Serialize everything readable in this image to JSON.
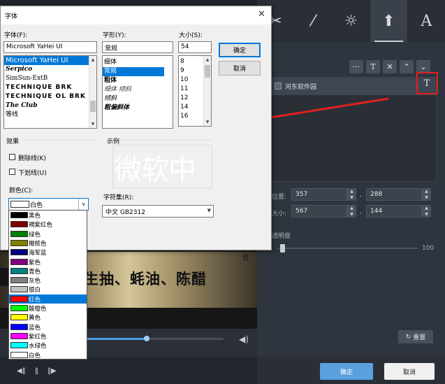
{
  "dialog": {
    "title": "字体",
    "font_label": "字体(F):",
    "font_value": "Microsoft YaHei UI",
    "font_list": [
      "Microsoft YaHei UI",
      "Serpico",
      "SimSun-ExtB",
      "TECHNIQUE BRK",
      "TECHNIQUE OL BRK",
      "The Club",
      "等线"
    ],
    "style_label": "字形(Y):",
    "style_value": "常规",
    "style_list": [
      "细体",
      "常规",
      "粗体",
      "细体 倾斜",
      "倾斜",
      "粗偏斜体"
    ],
    "size_label": "大小(S):",
    "size_value": "54",
    "size_list": [
      "8",
      "9",
      "10",
      "11",
      "12",
      "14",
      "16"
    ],
    "ok_label": "确定",
    "cancel_label": "取消",
    "effects_label": "效果",
    "strikeout_label": "删除线(K)",
    "underline_label": "下划线(U)",
    "color_label": "颜色(C):",
    "color_value": "白色",
    "sample_label": "示例",
    "sample_text": "微软中",
    "charset_label": "字符集(R):",
    "charset_value": "中文 GB2312",
    "colors": [
      {
        "name": "黑色",
        "hex": "#000000"
      },
      {
        "name": "褐紫红色",
        "hex": "#800000"
      },
      {
        "name": "绿色",
        "hex": "#008000"
      },
      {
        "name": "橄榄色",
        "hex": "#808000"
      },
      {
        "name": "海军蓝",
        "hex": "#000080"
      },
      {
        "name": "紫色",
        "hex": "#800080"
      },
      {
        "name": "青色",
        "hex": "#008080"
      },
      {
        "name": "灰色",
        "hex": "#808080"
      },
      {
        "name": "银白",
        "hex": "#c0c0c0"
      },
      {
        "name": "红色",
        "hex": "#ff0000"
      },
      {
        "name": "酸橙色",
        "hex": "#00ff00"
      },
      {
        "name": "黄色",
        "hex": "#ffff00"
      },
      {
        "name": "蓝色",
        "hex": "#0000ff"
      },
      {
        "name": "紫红色",
        "hex": "#ff00ff"
      },
      {
        "name": "水绿色",
        "hex": "#00ffff"
      },
      {
        "name": "白色",
        "hex": "#ffffff"
      }
    ],
    "selected_color_index": 9
  },
  "video": {
    "subtitle": "生抽、蚝油、陈醋"
  },
  "panel": {
    "layer_name": "河东软件园",
    "font_button_glyph": "T",
    "pos_label": "位置:",
    "pos_x": "357",
    "pos_y": "288",
    "size_label": "大小:",
    "size_w": "567",
    "size_h": "144",
    "opacity_label": "透明度",
    "opacity_max": "100",
    "opacity_value": 0,
    "reset_label": "重置",
    "ok_label": "确定",
    "cancel_label": "取消",
    "comma": ","
  },
  "colors": {
    "accent": "#0078d7",
    "highlight_box": "#e02020",
    "arrow": "#e02020",
    "ok_main": "#5aa0df"
  }
}
